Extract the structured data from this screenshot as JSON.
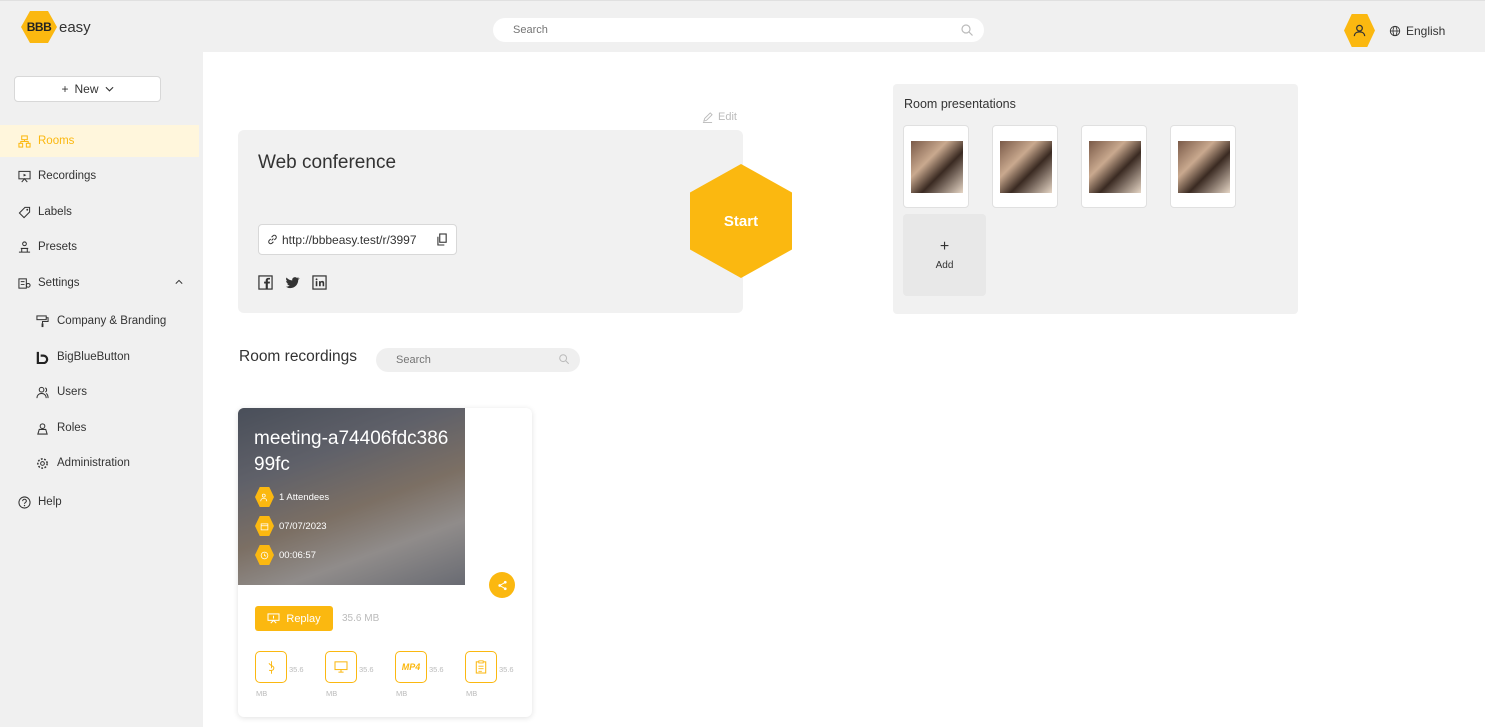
{
  "brand": {
    "logo_mark": "BBB",
    "name": "easy",
    "accent": "#fbb810"
  },
  "header": {
    "search_placeholder": "Search",
    "language": "English"
  },
  "sidebar": {
    "new_label": "New",
    "items": [
      {
        "label": "Rooms",
        "icon": "rooms-icon",
        "active": true
      },
      {
        "label": "Recordings",
        "icon": "recordings-icon"
      },
      {
        "label": "Labels",
        "icon": "label-icon"
      },
      {
        "label": "Presets",
        "icon": "presets-icon"
      },
      {
        "label": "Settings",
        "icon": "settings-icon",
        "expanded": true
      },
      {
        "label": "Company & Branding",
        "icon": "paint-roller-icon"
      },
      {
        "label": "BigBlueButton",
        "icon": "bigbluebutton-icon"
      },
      {
        "label": "Users",
        "icon": "users-icon"
      },
      {
        "label": "Roles",
        "icon": "roles-icon"
      },
      {
        "label": "Administration",
        "icon": "gear-icon"
      },
      {
        "label": "Help",
        "icon": "help-icon"
      }
    ]
  },
  "room": {
    "edit_label": "Edit",
    "title": "Web conference",
    "link": "http://bbbeasy.test/r/3997",
    "start_label": "Start"
  },
  "presentations": {
    "title": "Room presentations",
    "add_label": "Add"
  },
  "recordings": {
    "title": "Room recordings",
    "search_placeholder": "Search",
    "card": {
      "name": "meeting-a74406fdc38699fc",
      "attendees": "1 Attendees",
      "date": "07/07/2023",
      "duration": "00:06:57",
      "replay_label": "Replay",
      "replay_size": "35.6 MB",
      "formats": [
        {
          "icon": "audio-icon",
          "label": "",
          "size": "35.6",
          "unit": "MB"
        },
        {
          "icon": "screen-icon",
          "label": "",
          "size": "35.6",
          "unit": "MB"
        },
        {
          "icon": "mp4-icon",
          "label": "MP4",
          "size": "35.6",
          "unit": "MB"
        },
        {
          "icon": "notes-icon",
          "label": "",
          "size": "35.6",
          "unit": "MB"
        }
      ]
    }
  }
}
